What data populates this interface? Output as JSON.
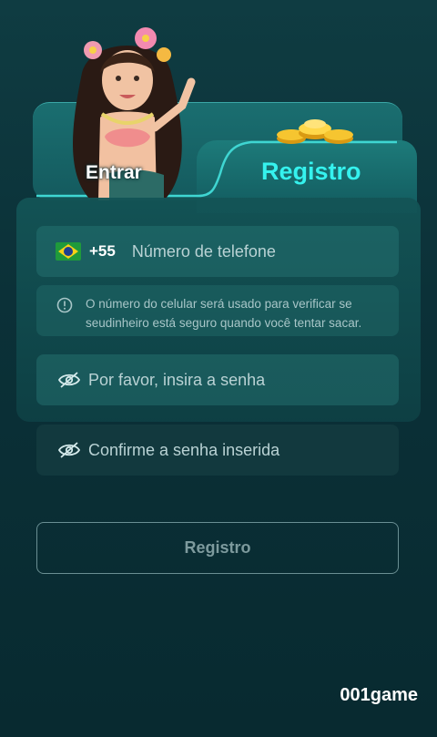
{
  "tabs": {
    "login": "Entrar",
    "register": "Registro"
  },
  "form": {
    "country_code": "+55",
    "phone_placeholder": "Número de telefone",
    "info_text": "O número do celular será usado para verificar se seudinheiro está seguro quando você tentar sacar.",
    "password_placeholder": "Por favor, insira a senha",
    "confirm_placeholder": "Confirme a senha inserida",
    "submit_label": "Registro"
  },
  "brand": "001game",
  "colors": {
    "accent": "#35f2ee",
    "background": "#0b3138",
    "panel": "#145a5e"
  },
  "icons": [
    "brazil-flag-icon",
    "info-icon",
    "eye-off-icon"
  ]
}
